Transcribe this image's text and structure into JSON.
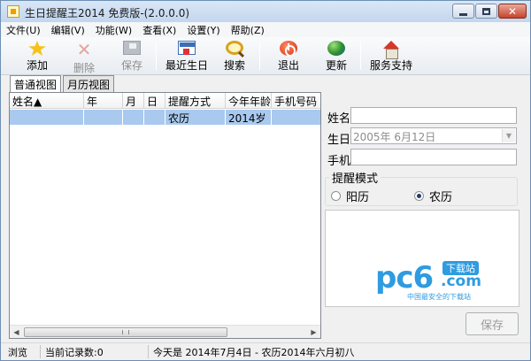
{
  "window": {
    "title": "生日提醒王2014 免费版-(2.0.0.0)",
    "close_glyph": "✕"
  },
  "menu": [
    "文件(U)",
    "编辑(V)",
    "功能(W)",
    "查看(X)",
    "设置(Y)",
    "帮助(Z)"
  ],
  "toolbar": {
    "add": "添加",
    "delete": "删除",
    "save": "保存",
    "recent_birthday": "最近生日",
    "search": "搜索",
    "exit": "退出",
    "update": "更新",
    "support": "服务支持"
  },
  "tabs": [
    "普通视图",
    "月历视图"
  ],
  "list": {
    "columns": [
      "姓名▲",
      "年",
      "月",
      "日",
      "提醒方式",
      "今年年龄",
      "手机号码"
    ],
    "rows": [
      [
        "",
        "",
        "",
        "",
        "农历",
        "2014岁",
        ""
      ]
    ]
  },
  "form": {
    "name_label": "姓名",
    "birthday_label": "生日",
    "birthday_value": "2005年  6月12日",
    "phone_label": "手机",
    "mode_group_title": "提醒模式",
    "mode_solar": "阳历",
    "mode_lunar": "农历",
    "mode_selected": "农历",
    "save_button": "保存"
  },
  "watermark": {
    "main": "pc6",
    "badge": "下载站",
    "domain": ".com",
    "slogan": "中国最安全的下载站"
  },
  "statusbar": {
    "mode": "浏览",
    "record_count": "当前记录数:0",
    "today": "今天是 2014年7月4日 - 农历2014年六月初八"
  }
}
